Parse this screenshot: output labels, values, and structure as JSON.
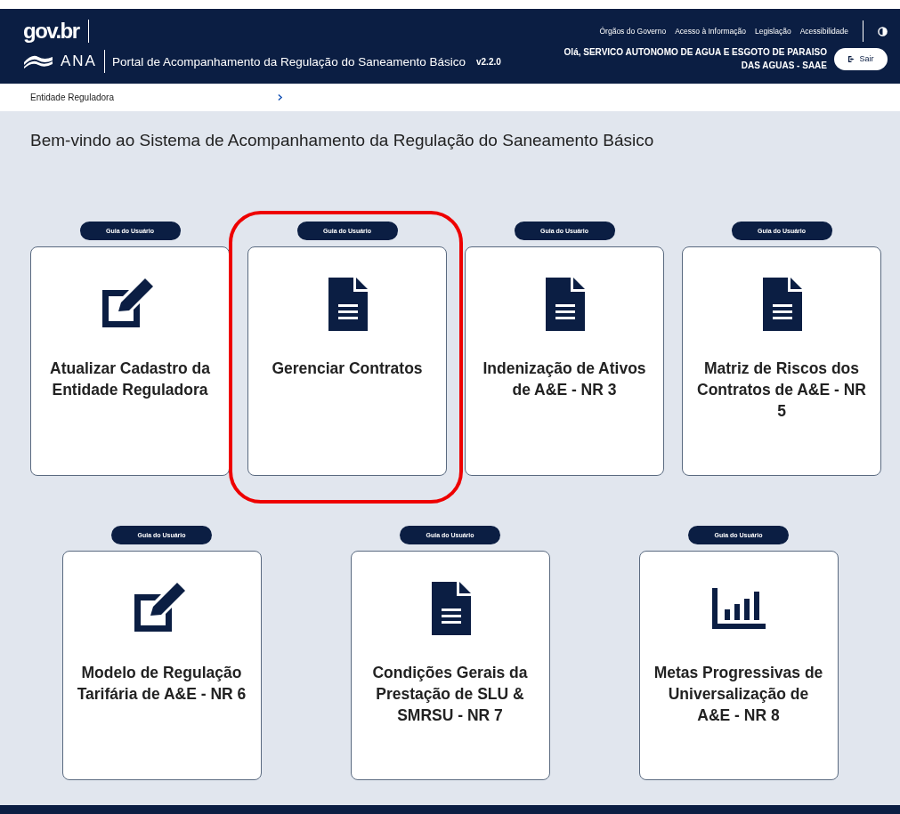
{
  "header": {
    "logo": "gov.br",
    "agency": "ANA",
    "portal_title": "Portal de Acompanhamento da Regulação do Saneamento Básico",
    "version": "v2.2.0",
    "links": [
      "Órgãos do Governo",
      "Acesso à Informação",
      "Legislação",
      "Acessibilidade"
    ],
    "greeting": "Olá, SERVICO AUTONOMO DE AGUA E ESGOTO DE PARAISO DAS AGUAS - SAAE",
    "logout": "Sair"
  },
  "breadcrumb": {
    "items": [
      "Entidade Reguladora"
    ]
  },
  "welcome": "Bem-vindo ao Sistema de Acompanhamento da Regulação do Saneamento Básico",
  "card_rows": [
    [
      {
        "guide": "Guia do Usuário",
        "kind": "edit",
        "title": "Atualizar Cadastro da Entidade Reguladora",
        "highlighted": false
      },
      {
        "guide": "Guia do Usuário",
        "kind": "document",
        "title": "Gerenciar Contratos",
        "highlighted": true
      },
      {
        "guide": "Guia do Usuário",
        "kind": "document",
        "title": "Indenização de Ativos de A&E - NR 3",
        "highlighted": false
      },
      {
        "guide": "Guia do Usuário",
        "kind": "document",
        "title": "Matriz de Riscos dos Contratos de A&E - NR 5",
        "highlighted": false
      }
    ],
    [
      {
        "guide": "Guia do Usuário",
        "kind": "edit",
        "title": "Modelo de Regulação Tarifária de A&E - NR 6",
        "highlighted": false
      },
      {
        "guide": "Guia do Usuário",
        "kind": "document",
        "title": "Condições Gerais da Prestação de SLU & SMRSU - NR 7",
        "highlighted": false
      },
      {
        "guide": "Guia do Usuário",
        "kind": "chart",
        "title": "Metas Progressivas de Universalização de A&E - NR 8",
        "highlighted": false
      }
    ]
  ]
}
